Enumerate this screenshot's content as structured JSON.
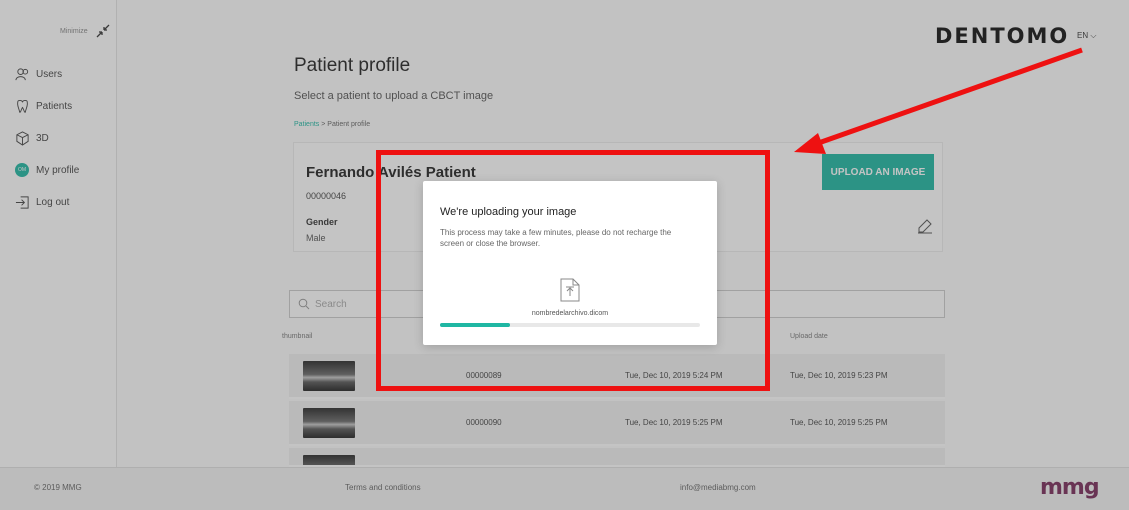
{
  "sidebar": {
    "minimize_label": "Minimize",
    "items": [
      {
        "label": "Users",
        "icon": "users-icon"
      },
      {
        "label": "Patients",
        "icon": "tooth-icon"
      },
      {
        "label": "3D",
        "icon": "cube-icon"
      },
      {
        "label": "My profile",
        "icon": "avatar-icon",
        "avatar_initials": "OM"
      },
      {
        "label": "Log out",
        "icon": "logout-icon"
      }
    ]
  },
  "header": {
    "logo": "DENTOMO",
    "language": "EN"
  },
  "page": {
    "title": "Patient profile",
    "subtitle": "Select a patient to upload a CBCT image",
    "breadcrumb_link": "Patients",
    "breadcrumb_current": "> Patient profile"
  },
  "patient": {
    "name": "Fernando Avilés Patient",
    "id": "00000046",
    "gender_label": "Gender",
    "gender_value": "Male",
    "upload_button": "UPLOAD AN IMAGE"
  },
  "search": {
    "placeholder": "Search"
  },
  "table": {
    "headers": [
      "thumbnail",
      "Upload date"
    ],
    "rows": [
      {
        "id": "00000089",
        "date1": "Tue, Dec 10, 2019 5:24 PM",
        "date2": "Tue, Dec 10, 2019 5:23 PM"
      },
      {
        "id": "00000090",
        "date1": "Tue, Dec 10, 2019 5:25 PM",
        "date2": "Tue, Dec 10, 2019 5:25 PM"
      }
    ]
  },
  "modal": {
    "title": "We're uploading your image",
    "text": "This process may take a few minutes, please do not recharge the screen or close the browser.",
    "file_name": "nombredelarchivo.dicom",
    "progress": 0.27
  },
  "footer": {
    "copyright": "© 2019 MMG",
    "terms": "Terms and conditions",
    "email": "info@mediabmg.com",
    "logo": "mmg"
  },
  "colors": {
    "accent": "#1fb7a3",
    "annotation": "#ee1111",
    "brand_footer": "#7a2b5a"
  }
}
